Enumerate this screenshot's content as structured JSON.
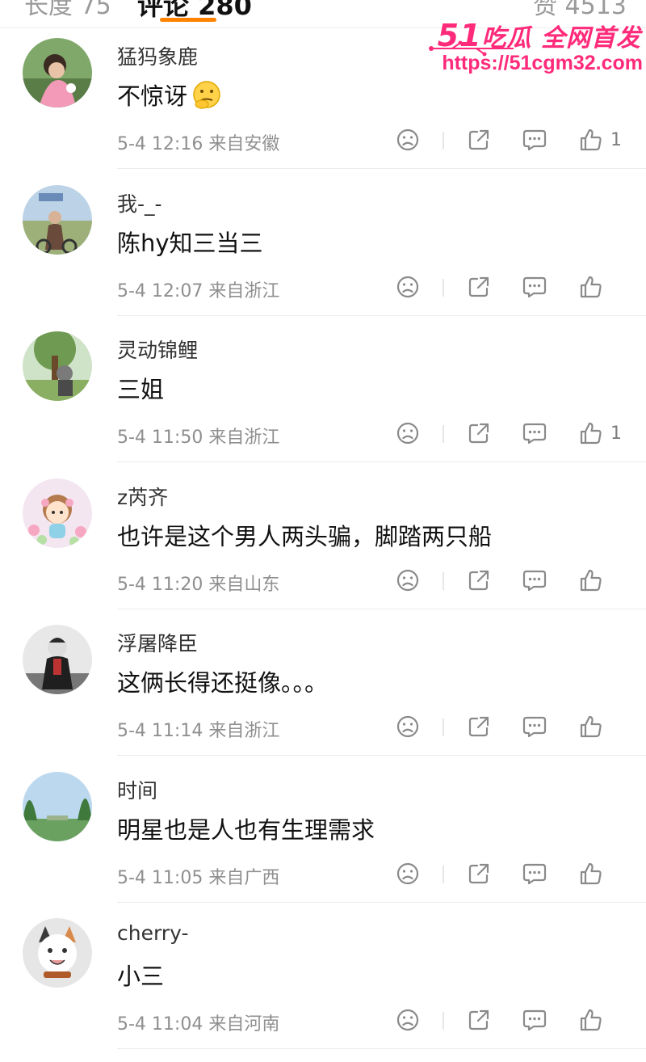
{
  "top_tabs": {
    "left": "长度 75",
    "center": "评论 280",
    "right": "赞 4513"
  },
  "watermark": {
    "line1_num": "51",
    "line1_text": "吃瓜 全网首发",
    "line2": "https://51cgm32.com"
  },
  "comments": [
    {
      "name": "猛犸象鹿",
      "text": "不惊讶",
      "emoji": "🤔",
      "time": "5-4 12:16",
      "location": "来自安徽",
      "likes": "1"
    },
    {
      "name": "我-_-",
      "text": "陈hy知三当三",
      "time": "5-4 12:07",
      "location": "来自浙江",
      "likes": ""
    },
    {
      "name": "灵动锦鲤",
      "text": "三姐",
      "time": "5-4 11:50",
      "location": "来自浙江",
      "likes": "1"
    },
    {
      "name": "z芮齐",
      "text": "也许是这个男人两头骗，脚踏两只船",
      "time": "5-4 11:20",
      "location": "来自山东",
      "likes": ""
    },
    {
      "name": "浮屠降臣",
      "text": "这俩长得还挺像。。。",
      "time": "5-4 11:14",
      "location": "来自浙江",
      "likes": ""
    },
    {
      "name": "时间",
      "text": "明星也是人也有生理需求",
      "time": "5-4 11:05",
      "location": "来自广西",
      "likes": ""
    },
    {
      "name": "cherry-",
      "text": "小三",
      "time": "5-4 11:04",
      "location": "来自河南",
      "likes": ""
    }
  ],
  "icons": {
    "dislike": "frown-icon",
    "share": "share-icon",
    "reply": "comment-icon",
    "like": "thumbs-up-icon"
  },
  "colors": {
    "accent": "#ff8200",
    "watermark": "#ff2a7a",
    "meta": "#8f8f8f"
  }
}
